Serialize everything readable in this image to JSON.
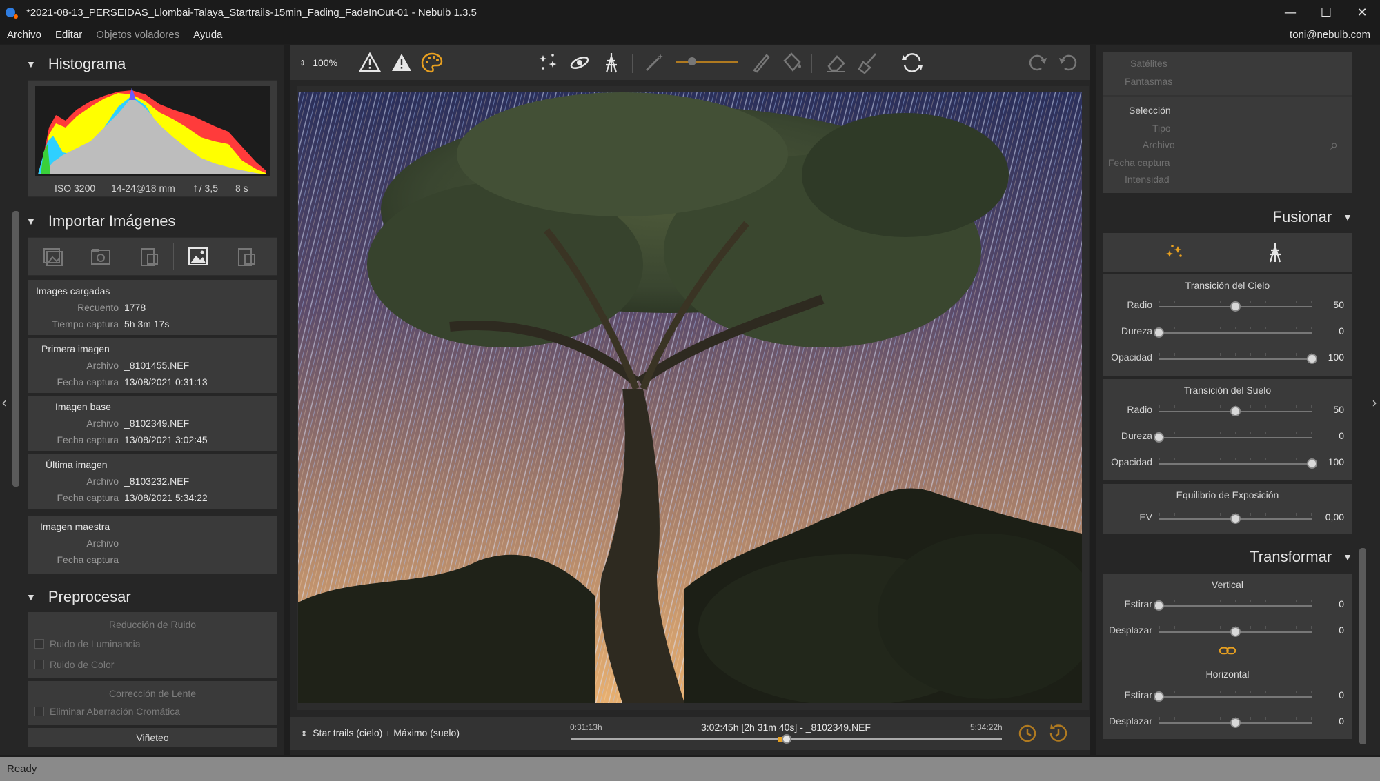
{
  "window": {
    "title": "*2021-08-13_PERSEIDAS_Llombai-Talaya_Startrails-15min_Fading_FadeInOut-01 - Nebulb 1.3.5",
    "minimize": "—",
    "maximize": "☐",
    "close": "✕"
  },
  "menu": {
    "items": [
      "Archivo",
      "Editar",
      "Objetos voladores",
      "Ayuda"
    ],
    "user": "toni@nebulb.com"
  },
  "histogram": {
    "title": "Histograma",
    "iso": "ISO 3200",
    "lens": "14-24@18 mm",
    "aperture": "f / 3,5",
    "shutter": "8 s"
  },
  "import": {
    "title": "Importar Imágenes",
    "loaded": {
      "heading": "Images cargadas",
      "count_label": "Recuento",
      "count": "1778",
      "time_label": "Tiempo captura",
      "time": "5h 3m 17s"
    },
    "first": {
      "heading": "Primera imagen",
      "file_label": "Archivo",
      "file": "_8101455.NEF",
      "date_label": "Fecha captura",
      "date": "13/08/2021 0:31:13"
    },
    "base": {
      "heading": "Imagen base",
      "file_label": "Archivo",
      "file": "_8102349.NEF",
      "date_label": "Fecha captura",
      "date": "13/08/2021 3:02:45"
    },
    "last": {
      "heading": "Última imagen",
      "file_label": "Archivo",
      "file": "_8103232.NEF",
      "date_label": "Fecha captura",
      "date": "13/08/2021 5:34:22"
    },
    "master": {
      "heading": "Imagen maestra",
      "file_label": "Archivo",
      "date_label": "Fecha captura"
    }
  },
  "preprocess": {
    "title": "Preprocesar",
    "noise_heading": "Reducción de Ruido",
    "luminance": "Ruido de Luminancia",
    "color": "Ruido de Color",
    "lens_heading": "Corrección de Lente",
    "chromatic": "Eliminar Aberración Cromática",
    "vignette": "Viñeteo"
  },
  "toolbar": {
    "zoom": "100%"
  },
  "bottom": {
    "mode": "Star trails (cielo) + Máximo (suelo)",
    "start": "0:31:13h",
    "end": "5:34:22h",
    "current": "3:02:45h [2h 31m 40s] - _8102349.NEF",
    "position": 0.5
  },
  "objects": {
    "satellites": "Satélites",
    "ghosts": "Fantasmas",
    "selection": "Selección",
    "type": "Tipo",
    "file": "Archivo",
    "date": "Fecha captura",
    "intensity": "Intensidad"
  },
  "merge": {
    "title": "Fusionar",
    "sky": {
      "heading": "Transición del Cielo",
      "radius_label": "Radio",
      "radius": "50",
      "radius_pos": 0.5,
      "hardness_label": "Dureza",
      "hardness": "0",
      "hardness_pos": 0,
      "opacity_label": "Opacidad",
      "opacity": "100",
      "opacity_pos": 1
    },
    "ground": {
      "heading": "Transición del Suelo",
      "radius_label": "Radio",
      "radius": "50",
      "radius_pos": 0.5,
      "hardness_label": "Dureza",
      "hardness": "0",
      "hardness_pos": 0,
      "opacity_label": "Opacidad",
      "opacity": "100",
      "opacity_pos": 1
    },
    "exposure": {
      "heading": "Equilibrio de Exposición",
      "ev_label": "EV",
      "ev": "0,00",
      "ev_pos": 0.5
    }
  },
  "transform": {
    "title": "Transformar",
    "vertical": {
      "heading": "Vertical",
      "stretch_label": "Estirar",
      "stretch": "0",
      "stretch_pos": 0,
      "shift_label": "Desplazar",
      "shift": "0",
      "shift_pos": 0.5
    },
    "horizontal": {
      "heading": "Horizontal",
      "stretch_label": "Estirar",
      "stretch": "0",
      "stretch_pos": 0,
      "shift_label": "Desplazar",
      "shift": "0",
      "shift_pos": 0.5
    }
  },
  "status": "Ready",
  "colors": {
    "accent": "#e8a020",
    "panel": "#3a3a3a",
    "background": "#262626"
  }
}
